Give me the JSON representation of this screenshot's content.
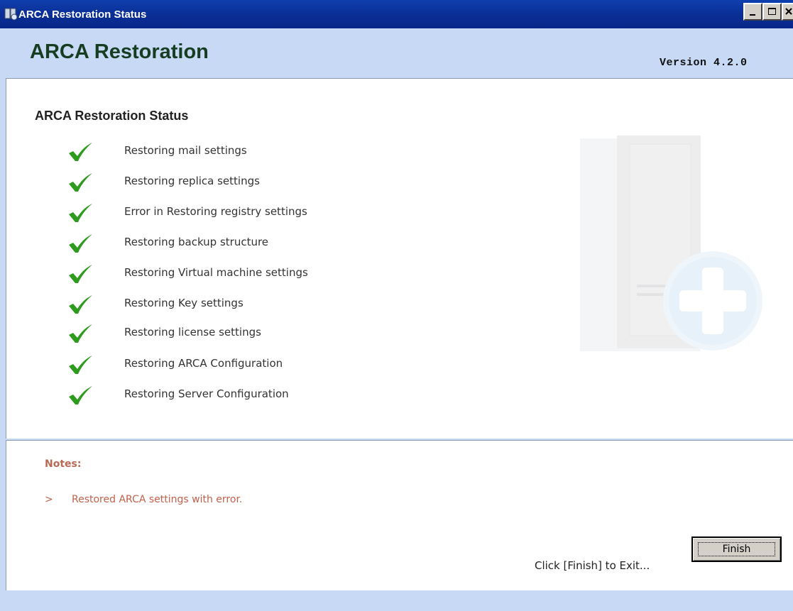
{
  "window": {
    "title": "ARCA Restoration Status",
    "controls": [
      "minimize",
      "maximize",
      "close"
    ]
  },
  "header": {
    "app_title": "ARCA Restoration",
    "version": "Version 4.2.0"
  },
  "status": {
    "section_title": "ARCA Restoration Status",
    "check_color": "#2e9a1e",
    "steps": [
      {
        "label": "Restoring mail settings",
        "state": "done"
      },
      {
        "label": "Restoring replica settings",
        "state": "done"
      },
      {
        "label": "Error in Restoring registry settings",
        "state": "done"
      },
      {
        "label": "Restoring backup structure",
        "state": "done"
      },
      {
        "label": "Restoring Virtual machine settings",
        "state": "done"
      },
      {
        "label": "Restoring Key settings",
        "state": "done"
      },
      {
        "label": "Restoring license settings",
        "state": "done"
      },
      {
        "label": "Restoring ARCA Configuration",
        "state": "done"
      },
      {
        "label": "Restoring Server Configuration",
        "state": "done"
      }
    ]
  },
  "notes": {
    "title": "Notes:",
    "bullet": ">",
    "items": [
      "Restored ARCA settings with error."
    ],
    "accent_color": "#c0614a"
  },
  "footer": {
    "exit_hint": "Click [Finish] to Exit...",
    "finish_label": "Finish"
  }
}
